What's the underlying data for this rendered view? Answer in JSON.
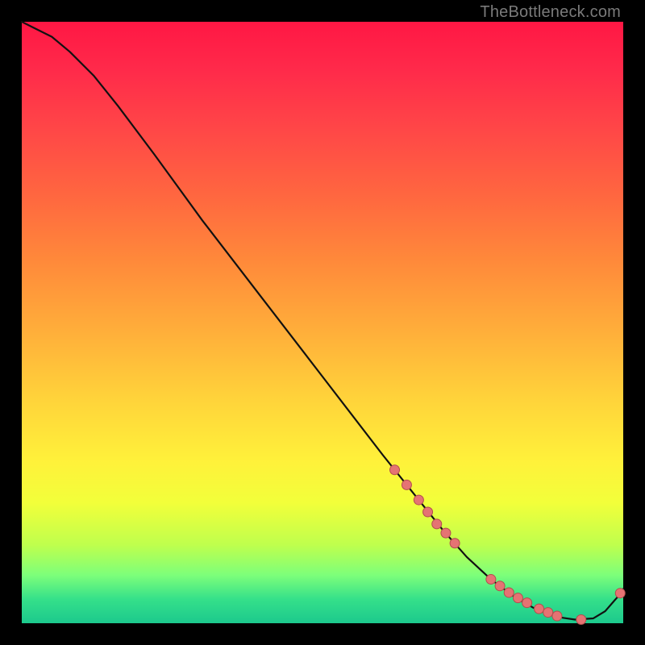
{
  "attribution": "TheBottleneck.com",
  "colors": {
    "bg": "#000000",
    "attribution_text": "#7a7a7a",
    "curve": "#111111",
    "dot_fill": "#e57373",
    "dot_stroke": "#b24d4d"
  },
  "chart_data": {
    "type": "line",
    "title": "",
    "xlabel": "",
    "ylabel": "",
    "xlim": [
      0,
      100
    ],
    "ylim": [
      0,
      100
    ],
    "grid": false,
    "legend": false,
    "x": [
      0,
      2,
      5,
      8,
      12,
      16,
      22,
      30,
      40,
      50,
      60,
      66,
      70,
      74,
      78,
      82,
      85,
      88,
      90,
      92,
      95,
      97,
      99,
      100
    ],
    "y": [
      100,
      99,
      97.5,
      95,
      91,
      86,
      78,
      67,
      54,
      41,
      28,
      20.5,
      15.5,
      11,
      7.3,
      4.3,
      2.6,
      1.4,
      0.9,
      0.6,
      0.8,
      2.0,
      4.3,
      5.7
    ],
    "markers": {
      "x": [
        62,
        64,
        66,
        67.5,
        69,
        70.5,
        72,
        78,
        79.5,
        81,
        82.5,
        84,
        86,
        87.5,
        89,
        93,
        99.5
      ],
      "y": [
        25.5,
        23,
        20.5,
        18.5,
        16.5,
        15,
        13.3,
        7.3,
        6.2,
        5.1,
        4.2,
        3.4,
        2.4,
        1.8,
        1.2,
        0.6,
        5.0
      ]
    }
  }
}
